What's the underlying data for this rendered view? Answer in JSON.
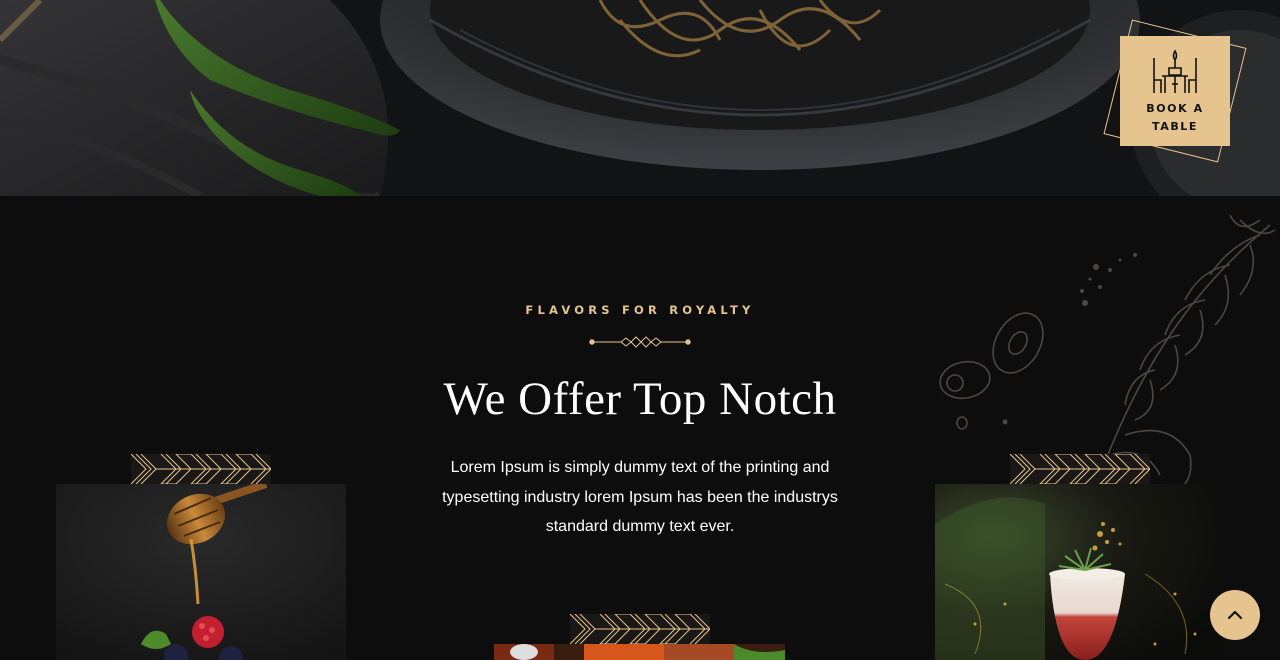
{
  "book_table": {
    "label": "BOOK A TABLE",
    "icon": "dining-table-icon"
  },
  "section": {
    "eyebrow": "FLAVORS FOR ROYALTY",
    "title": "We Offer Top Notch",
    "description": "Lorem Ipsum is simply dummy text of the printing and typesetting industry lorem Ipsum has been the industrys standard dummy text ever."
  },
  "cards": [
    {
      "subject": "honey-dipper-berries"
    },
    {
      "subject": "plated-dish"
    },
    {
      "subject": "cocktail-garnish"
    }
  ],
  "scroll_top": {
    "icon": "chevron-up-icon"
  },
  "colors": {
    "accent": "#e6c48f",
    "background": "#0e0d0d"
  }
}
